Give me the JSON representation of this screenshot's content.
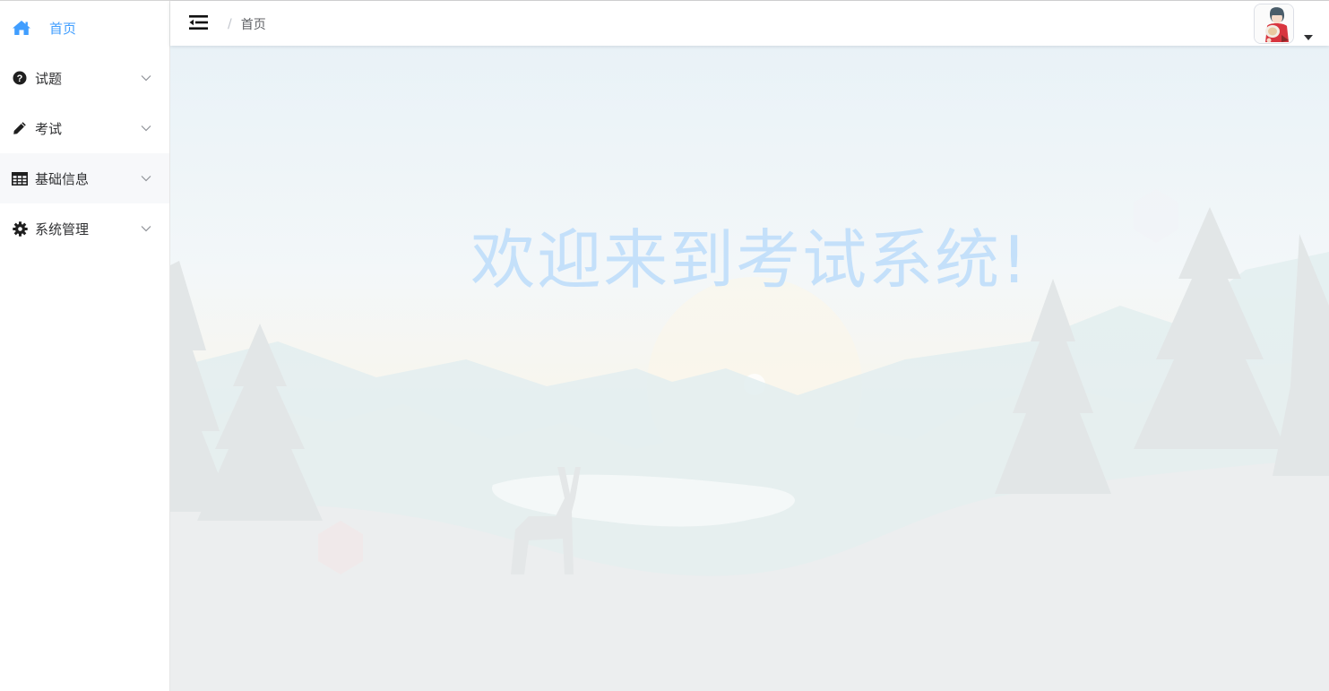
{
  "sidebar": {
    "items": [
      {
        "label": "首页",
        "icon": "home-icon",
        "active": true
      },
      {
        "label": "试题",
        "icon": "question-circle-icon"
      },
      {
        "label": "考试",
        "icon": "pencil-icon"
      },
      {
        "label": "基础信息",
        "icon": "table-icon"
      },
      {
        "label": "系统管理",
        "icon": "gear-icon"
      }
    ]
  },
  "header": {
    "breadcrumb_separator": "/",
    "breadcrumb_current": "首页"
  },
  "main": {
    "welcome_text": "欢迎来到考试系统!"
  },
  "colors": {
    "accent": "#409eff",
    "welcome": "#c4e0fa"
  }
}
